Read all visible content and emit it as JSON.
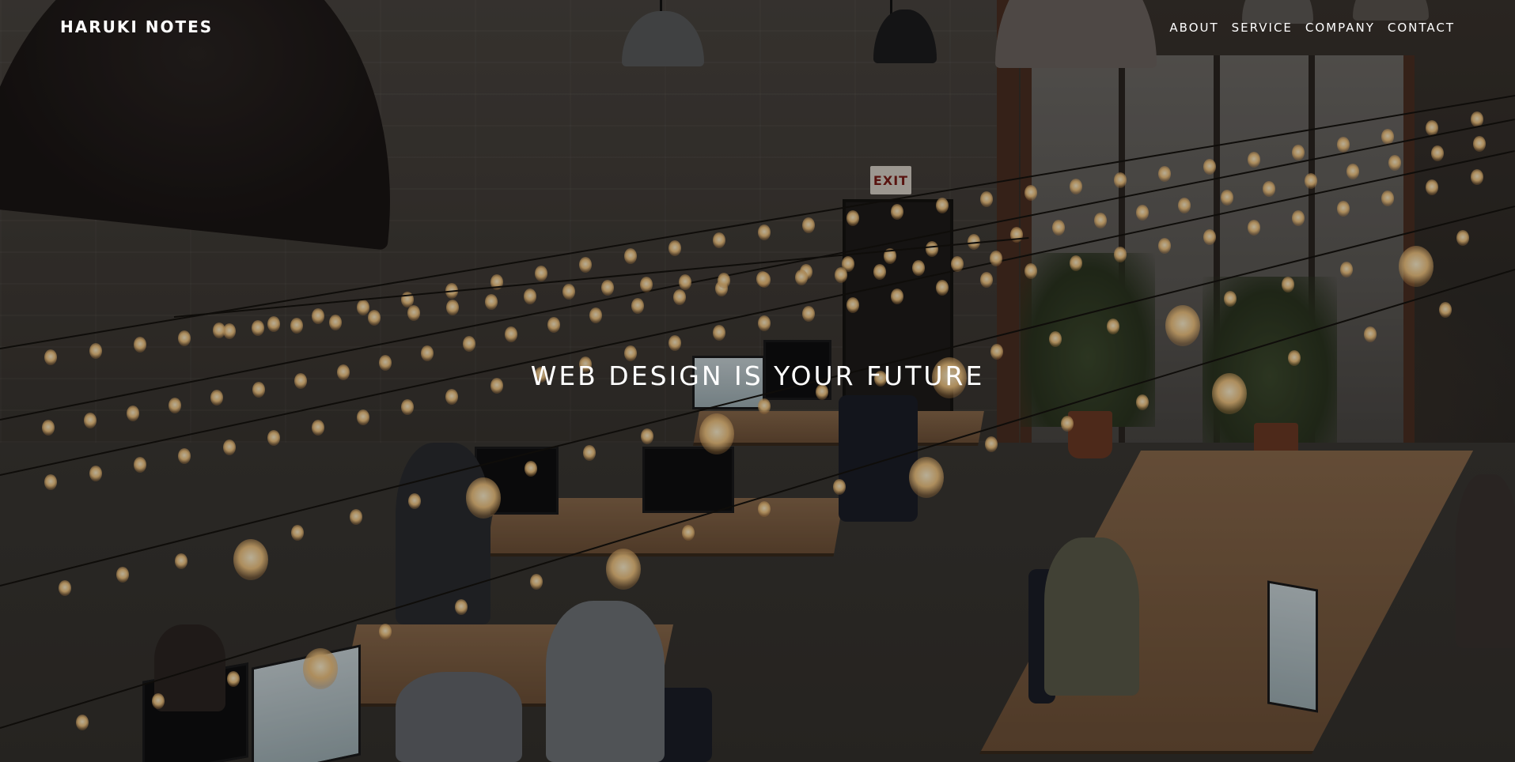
{
  "site": {
    "brand": "HARUKI NOTES"
  },
  "nav": {
    "items": [
      {
        "label": "ABOUT"
      },
      {
        "label": "SERVICE"
      },
      {
        "label": "COMPANY"
      },
      {
        "label": "CONTACT"
      }
    ]
  },
  "hero": {
    "headline": "WEB DESIGN IS YOUR FUTURE",
    "background_description_icon": "office-photo",
    "exit_sign": "EXIT"
  },
  "colors": {
    "text": "#ffffff",
    "overlay": "#000000"
  }
}
